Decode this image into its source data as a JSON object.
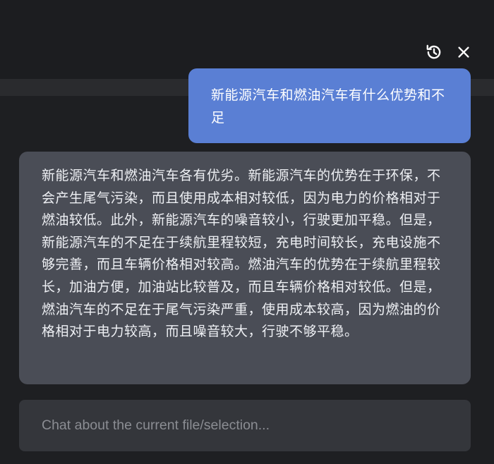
{
  "toolbar": {
    "history_icon": "history-icon",
    "close_icon": "close-icon"
  },
  "conversation": {
    "user_message": "新能源汽车和燃油汽车有什么优势和不足",
    "assistant_message": "新能源汽车和燃油汽车各有优劣。新能源汽车的优势在于环保，不会产生尾气污染，而且使用成本相对较低，因为电力的价格相对于燃油较低。此外，新能源汽车的噪音较小，行驶更加平稳。但是，新能源汽车的不足在于续航里程较短，充电时间较长，充电设施不够完善，而且车辆价格相对较高。燃油汽车的优势在于续航里程较长，加油方便，加油站比较普及，而且车辆价格相对较低。但是，燃油汽车的不足在于尾气污染严重，使用成本较高，因为燃油的价格相对于电力较高，而且噪音较大，行驶不够平稳。"
  },
  "input": {
    "placeholder": "Chat about the current file/selection...",
    "value": ""
  },
  "colors": {
    "background": "#1e1f22",
    "user_bubble": "#5a7fd4",
    "assistant_bubble": "#4a4d56",
    "input_background": "#34363b"
  }
}
